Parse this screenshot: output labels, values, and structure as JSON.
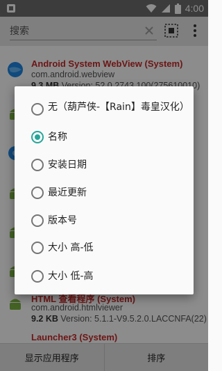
{
  "status_bar": {
    "time": "4:00"
  },
  "toolbar": {
    "search_placeholder": "搜索"
  },
  "app_list": [
    {
      "name": "Android System WebView (System)",
      "package": "com.android.webview",
      "size": "9.3 MB",
      "version": " Version: 52.0.2743.100(275610010)"
    },
    {
      "name": "HTML 查看程序 (System)",
      "package": "com.android.htmlviewer",
      "size": "9.2 KB",
      "version": " Version: 5.1.1-V9.5.2.0.LACCNFA(22)"
    },
    {
      "name": "Launcher3 (System)"
    }
  ],
  "sort_dialog": {
    "options": [
      {
        "label": "无（葫芦侠-【Rain】毒皇汉化）",
        "checked": false
      },
      {
        "label": "名称",
        "checked": true
      },
      {
        "label": "安装日期",
        "checked": false
      },
      {
        "label": "最近更新",
        "checked": false
      },
      {
        "label": "版本号",
        "checked": false
      },
      {
        "label": "大小 高-低",
        "checked": false
      },
      {
        "label": "大小 低-高",
        "checked": false
      }
    ]
  },
  "bottom_bar": {
    "show_apps_label": "显示应用程序",
    "sort_label": "排序"
  },
  "colors": {
    "accent": "#26a69a",
    "app_name": "#c62828",
    "status_bar": "#6e6e6e"
  }
}
